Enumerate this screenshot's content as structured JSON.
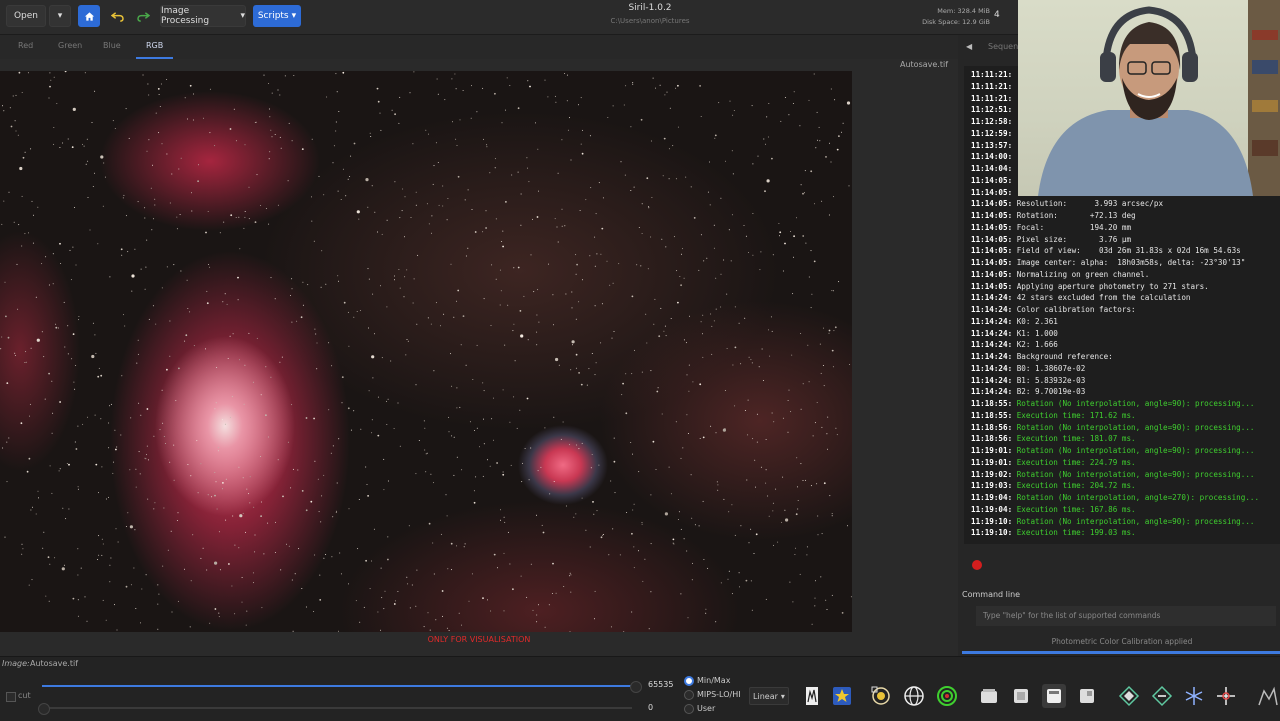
{
  "toolbar": {
    "open_label": "Open",
    "image_processing_label": "Image Processing",
    "scripts_label": "Scripts",
    "app_title": "Siril-1.0.2",
    "path": "C:\\Users\\anon\\Pictures",
    "mem": "Mem: 328.4 MiB",
    "disk": "Disk Space: 12.9 GiB",
    "counter": "4"
  },
  "tabs": [
    "Red",
    "Green",
    "Blue",
    "RGB"
  ],
  "viewer": {
    "filename_tag": "Autosave.tif",
    "visualisation_note": "ONLY FOR VISUALISATION"
  },
  "right_panel": {
    "sequence_tab": "Sequen",
    "command_label": "Command line",
    "command_placeholder": "Type \"help\" for the list of supported commands",
    "status": "Photometric Color Calibration applied"
  },
  "console": [
    {
      "ts": "11:11:21:",
      "msg": "",
      "green": false
    },
    {
      "ts": "11:11:21:",
      "msg": "",
      "green": false
    },
    {
      "ts": "11:11:21:",
      "msg": "",
      "green": false
    },
    {
      "ts": "11:12:51:",
      "msg": "",
      "green": false
    },
    {
      "ts": "11:12:58:",
      "msg": "",
      "green": false
    },
    {
      "ts": "11:12:59:",
      "msg": "",
      "green": false
    },
    {
      "ts": "11:13:57:",
      "msg": "",
      "green": false
    },
    {
      "ts": "11:14:00:",
      "msg": "",
      "green": false
    },
    {
      "ts": "11:14:04:",
      "msg": "",
      "green": false
    },
    {
      "ts": "11:14:05:",
      "msg": "",
      "green": false
    },
    {
      "ts": "11:14:05:",
      "msg": "",
      "green": false
    },
    {
      "ts": "11:14:05:",
      "msg": "Resolution:      3.993 arcsec/px",
      "green": false
    },
    {
      "ts": "11:14:05:",
      "msg": "Rotation:       +72.13 deg",
      "green": false
    },
    {
      "ts": "11:14:05:",
      "msg": "Focal:          194.20 mm",
      "green": false
    },
    {
      "ts": "11:14:05:",
      "msg": "Pixel size:       3.76 µm",
      "green": false
    },
    {
      "ts": "11:14:05:",
      "msg": "Field of view:    03d 26m 31.83s x 02d 16m 54.63s",
      "green": false
    },
    {
      "ts": "11:14:05:",
      "msg": "Image center: alpha:  18h03m58s, delta: -23°30'13\"",
      "green": false
    },
    {
      "ts": "11:14:05:",
      "msg": "Normalizing on green channel.",
      "green": false
    },
    {
      "ts": "11:14:05:",
      "msg": "Applying aperture photometry to 271 stars.",
      "green": false
    },
    {
      "ts": "11:14:24:",
      "msg": "42 stars excluded from the calculation",
      "green": false
    },
    {
      "ts": "11:14:24:",
      "msg": "Color calibration factors:",
      "green": false
    },
    {
      "ts": "11:14:24:",
      "msg": "K0: 2.361",
      "green": false
    },
    {
      "ts": "11:14:24:",
      "msg": "K1: 1.000",
      "green": false
    },
    {
      "ts": "11:14:24:",
      "msg": "K2: 1.666",
      "green": false
    },
    {
      "ts": "11:14:24:",
      "msg": "Background reference:",
      "green": false
    },
    {
      "ts": "11:14:24:",
      "msg": "B0: 1.38607e-02",
      "green": false
    },
    {
      "ts": "11:14:24:",
      "msg": "B1: 5.83932e-03",
      "green": false
    },
    {
      "ts": "11:14:24:",
      "msg": "B2: 9.70019e-03",
      "green": false
    },
    {
      "ts": "11:18:55:",
      "msg": "Rotation (No interpolation, angle=90): processing...",
      "green": true
    },
    {
      "ts": "11:18:55:",
      "msg": "Execution time: 171.62 ms.",
      "green": true
    },
    {
      "ts": "11:18:56:",
      "msg": "Rotation (No interpolation, angle=90): processing...",
      "green": true
    },
    {
      "ts": "11:18:56:",
      "msg": "Execution time: 181.07 ms.",
      "green": true
    },
    {
      "ts": "11:19:01:",
      "msg": "Rotation (No interpolation, angle=90): processing...",
      "green": true
    },
    {
      "ts": "11:19:01:",
      "msg": "Execution time: 224.79 ms.",
      "green": true
    },
    {
      "ts": "11:19:02:",
      "msg": "Rotation (No interpolation, angle=90): processing...",
      "green": true
    },
    {
      "ts": "11:19:03:",
      "msg": "Execution time: 204.72 ms.",
      "green": true
    },
    {
      "ts": "11:19:04:",
      "msg": "Rotation (No interpolation, angle=270): processing...",
      "green": true
    },
    {
      "ts": "11:19:04:",
      "msg": "Execution time: 167.86 ms.",
      "green": true
    },
    {
      "ts": "11:19:10:",
      "msg": "Rotation (No interpolation, angle=90): processing...",
      "green": true
    },
    {
      "ts": "11:19:10:",
      "msg": "Execution time: 199.03 ms.",
      "green": true
    }
  ],
  "bottom": {
    "image_label": "Image:",
    "image_name": "Autosave.tif",
    "cut_label": "cut",
    "max_value": "65535",
    "min_value": "0",
    "radio_minmax": "Min/Max",
    "radio_mips": "MIPS-LO/HI",
    "radio_user": "User",
    "stretch_label": "Linear"
  },
  "colors": {
    "accent": "#2d6bd6",
    "console_green": "#3fcf2f",
    "warning_red": "#e02a2a"
  }
}
